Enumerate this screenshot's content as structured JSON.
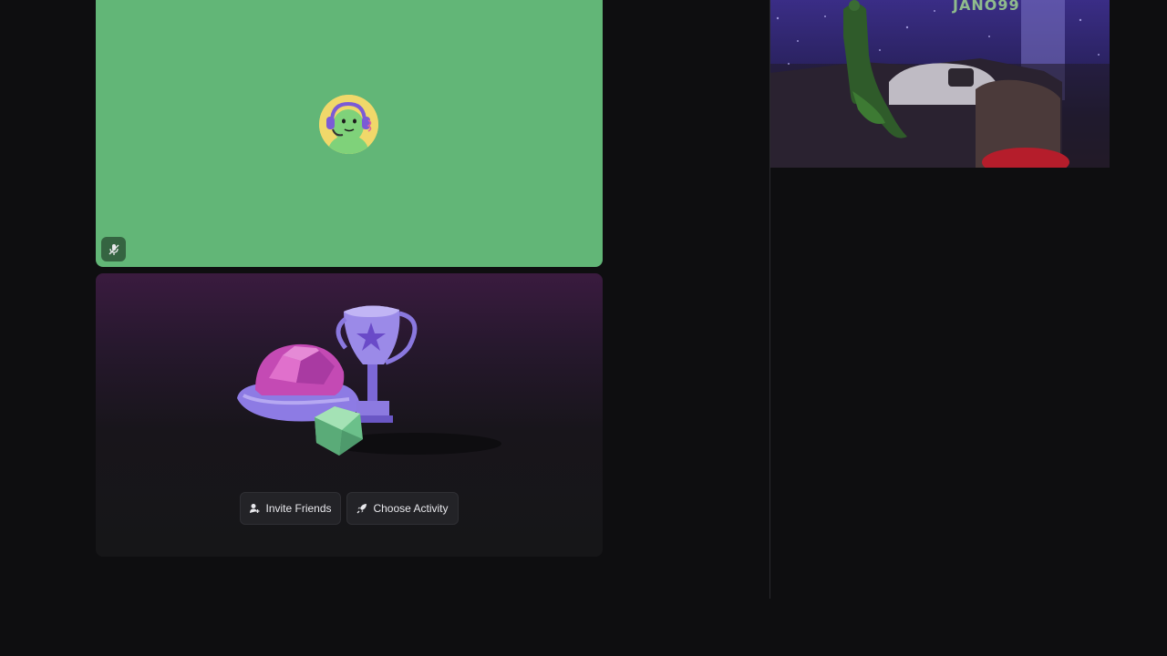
{
  "voice_channel": {
    "participant_tile": {
      "background_color": "#62b677",
      "avatar_color": "#f0d86a",
      "muted": true
    },
    "activity_panel": {
      "invite_button_label": "Invite Friends",
      "invite_icon": "user-add-icon",
      "activity_button_label": "Choose Activity",
      "activity_icon": "rocket-icon"
    },
    "camera_feed": {
      "wall_text": "JANO99"
    }
  }
}
